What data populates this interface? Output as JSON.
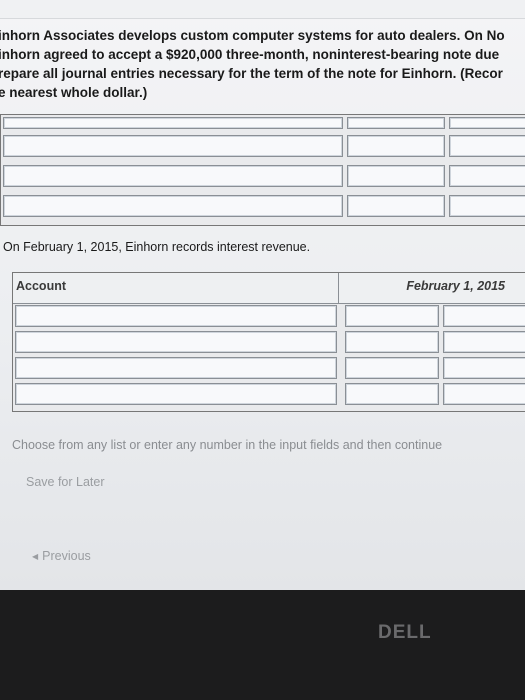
{
  "problem": {
    "lines": [
      "inhorn Associates develops custom computer systems for auto dealers. On No",
      "inhorn agreed to accept a $920,000 three-month, noninterest-bearing note due",
      "repare all journal entries necessary for the term of the note for Einhorn. (Recor",
      "e nearest whole dollar.)"
    ]
  },
  "entry_label": "On February 1, 2015, Einhorn records interest revenue.",
  "journal_table": {
    "account_header": "Account",
    "date_header": "February 1, 2015"
  },
  "instruction": "Choose from any list or enter any number in the input fields and then continue",
  "save_later": "Save for Later",
  "previous": "Previous",
  "brand": "DELL"
}
